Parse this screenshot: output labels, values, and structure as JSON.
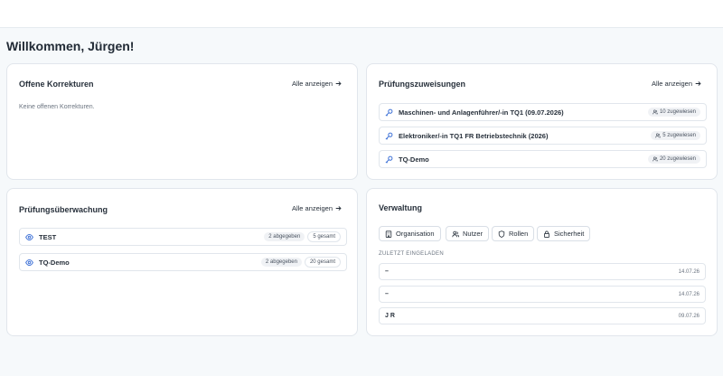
{
  "welcome": "Willkommen, Jürgen!",
  "show_all": "Alle anzeigen",
  "korrekturen": {
    "title": "Offene Korrekturen",
    "empty": "Keine offenen Korrekturen."
  },
  "zuweisungen": {
    "title": "Prüfungszuweisungen",
    "items": [
      {
        "name": "Maschinen- und Anlagenführer/-in TQ1 (09.07.2026)",
        "badge": "10 zugewiesen"
      },
      {
        "name": "Elektroniker/-in TQ1 FR Betriebstechnik (2026)",
        "badge": "5 zugewiesen"
      },
      {
        "name": "TQ-Demo",
        "badge": "20 zugewiesen"
      }
    ]
  },
  "ueberwachung": {
    "title": "Prüfungsüberwachung",
    "items": [
      {
        "name": "TEST",
        "submitted": "2 abgegeben",
        "total": "5 gesamt"
      },
      {
        "name": "TQ-Demo",
        "submitted": "2 abgegeben",
        "total": "20 gesamt"
      }
    ]
  },
  "verwaltung": {
    "title": "Verwaltung",
    "buttons": [
      {
        "label": "Organisation",
        "icon": "building-icon"
      },
      {
        "label": "Nutzer",
        "icon": "users-icon"
      },
      {
        "label": "Rollen",
        "icon": "shield-icon"
      },
      {
        "label": "Sicherheit",
        "icon": "lock-icon"
      }
    ],
    "recent_label": "Zuletzt eingeladen",
    "invites": [
      {
        "name": "–",
        "date": "14.07.26"
      },
      {
        "name": "–",
        "date": "14.07.26"
      },
      {
        "name": "J R",
        "date": "09.07.26"
      }
    ]
  }
}
